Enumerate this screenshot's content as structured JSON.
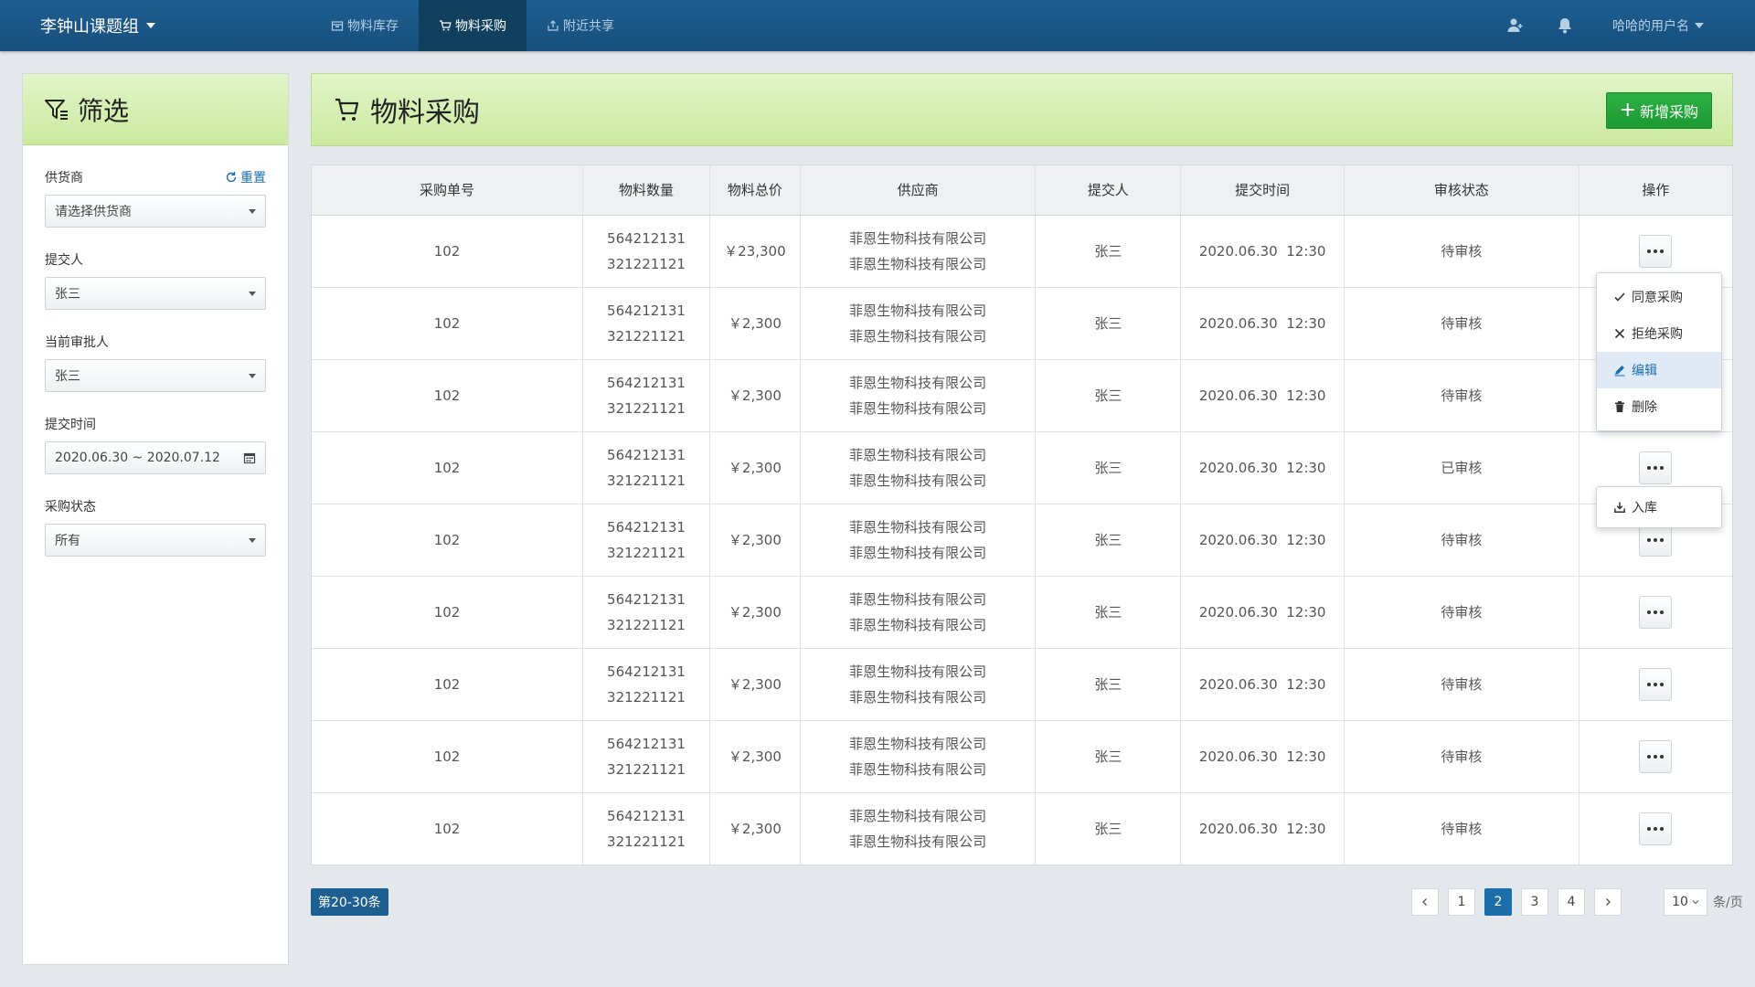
{
  "navbar": {
    "brand": "李钟山课题组",
    "tabs": [
      {
        "label": "物料库存",
        "icon": "box-icon"
      },
      {
        "label": "物料采购",
        "icon": "cart-icon"
      },
      {
        "label": "附近共享",
        "icon": "share-icon"
      }
    ],
    "active_tab": "物料采购",
    "username": "哈哈的用户名"
  },
  "sidebar": {
    "title": "筛选",
    "reset_label": "重置",
    "filters": [
      {
        "label": "供货商",
        "value": "请选择供货商",
        "type": "select"
      },
      {
        "label": "提交人",
        "value": "张三",
        "type": "select"
      },
      {
        "label": "当前审批人",
        "value": "张三",
        "type": "select"
      },
      {
        "label": "提交时间",
        "value": "2020.06.30 ~ 2020.07.12",
        "type": "date-range"
      },
      {
        "label": "采购状态",
        "value": "所有",
        "type": "select"
      }
    ]
  },
  "main": {
    "title": "物料采购",
    "add_button": "新增采购",
    "columns": [
      "采购单号",
      "物料数量",
      "物料总价",
      "供应商",
      "提交人",
      "提交时间",
      "审核状态",
      "操作"
    ],
    "rows": [
      {
        "id": "102",
        "qty1": "564212131",
        "qty2": "321221121",
        "price": "￥23,300",
        "supplier1": "菲恩生物科技有限公司",
        "supplier2": "菲恩生物科技有限公司",
        "submitter": "张三",
        "time": "2020.06.30  12:30",
        "status": "待审核"
      },
      {
        "id": "102",
        "qty1": "564212131",
        "qty2": "321221121",
        "price": "￥2,300",
        "supplier1": "菲恩生物科技有限公司",
        "supplier2": "菲恩生物科技有限公司",
        "submitter": "张三",
        "time": "2020.06.30  12:30",
        "status": "待审核"
      },
      {
        "id": "102",
        "qty1": "564212131",
        "qty2": "321221121",
        "price": "￥2,300",
        "supplier1": "菲恩生物科技有限公司",
        "supplier2": "菲恩生物科技有限公司",
        "submitter": "张三",
        "time": "2020.06.30  12:30",
        "status": "待审核"
      },
      {
        "id": "102",
        "qty1": "564212131",
        "qty2": "321221121",
        "price": "￥2,300",
        "supplier1": "菲恩生物科技有限公司",
        "supplier2": "菲恩生物科技有限公司",
        "submitter": "张三",
        "time": "2020.06.30  12:30",
        "status": "已审核"
      },
      {
        "id": "102",
        "qty1": "564212131",
        "qty2": "321221121",
        "price": "￥2,300",
        "supplier1": "菲恩生物科技有限公司",
        "supplier2": "菲恩生物科技有限公司",
        "submitter": "张三",
        "time": "2020.06.30  12:30",
        "status": "待审核"
      },
      {
        "id": "102",
        "qty1": "564212131",
        "qty2": "321221121",
        "price": "￥2,300",
        "supplier1": "菲恩生物科技有限公司",
        "supplier2": "菲恩生物科技有限公司",
        "submitter": "张三",
        "time": "2020.06.30  12:30",
        "status": "待审核"
      },
      {
        "id": "102",
        "qty1": "564212131",
        "qty2": "321221121",
        "price": "￥2,300",
        "supplier1": "菲恩生物科技有限公司",
        "supplier2": "菲恩生物科技有限公司",
        "submitter": "张三",
        "time": "2020.06.30  12:30",
        "status": "待审核"
      },
      {
        "id": "102",
        "qty1": "564212131",
        "qty2": "321221121",
        "price": "￥2,300",
        "supplier1": "菲恩生物科技有限公司",
        "supplier2": "菲恩生物科技有限公司",
        "submitter": "张三",
        "time": "2020.06.30  12:30",
        "status": "待审核"
      },
      {
        "id": "102",
        "qty1": "564212131",
        "qty2": "321221121",
        "price": "￥2,300",
        "supplier1": "菲恩生物科技有限公司",
        "supplier2": "菲恩生物科技有限公司",
        "submitter": "张三",
        "time": "2020.06.30  12:30",
        "status": "待审核"
      }
    ],
    "menu_pending": [
      {
        "label": "同意采购",
        "icon": "check-icon"
      },
      {
        "label": "拒绝采购",
        "icon": "close-icon"
      },
      {
        "label": "编辑",
        "icon": "pencil-icon",
        "active": true
      },
      {
        "label": "删除",
        "icon": "trash-icon"
      }
    ],
    "menu_approved": [
      {
        "label": "入库",
        "icon": "download-icon"
      }
    ]
  },
  "footer": {
    "range_label": "第20-30条",
    "pages": [
      "1",
      "2",
      "3",
      "4"
    ],
    "current_page": "2",
    "page_size": "10",
    "per_page_label": "条/页"
  },
  "colors": {
    "navbar": "#1d5f91",
    "header_green": "#cbea9f",
    "add_button": "#1c9a33",
    "accent": "#1a6fb3"
  }
}
